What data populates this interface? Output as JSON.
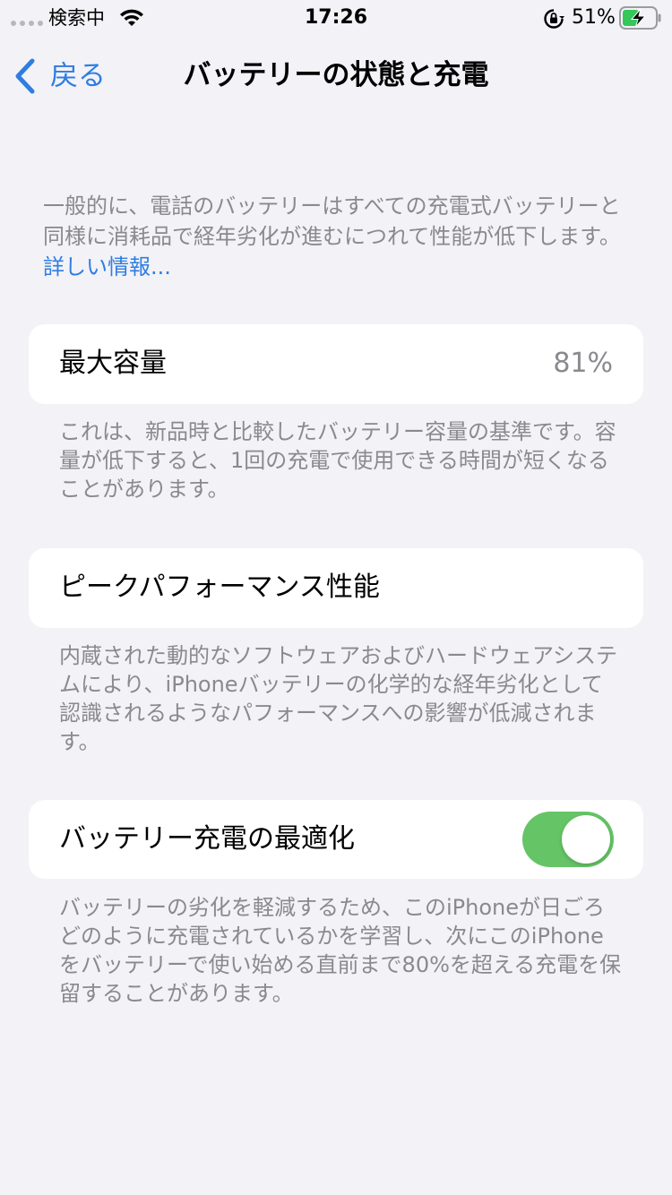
{
  "status_bar": {
    "carrier": "検索中",
    "time": "17:26",
    "battery_percent": "51%",
    "icons": [
      "signal-dots-icon",
      "wifi-icon",
      "rotation-lock-icon",
      "battery-charging-icon"
    ],
    "battery_level": 0.51
  },
  "nav": {
    "back_label": "戻る",
    "title": "バッテリーの状態と充電"
  },
  "intro": {
    "text": "一般的に、電話のバッテリーはすべての充電式バッテリーと同様に消耗品で経年劣化が進むにつれて性能が低下します。",
    "link": "詳しい情報..."
  },
  "max_capacity": {
    "label": "最大容量",
    "value": "81%",
    "footer": "これは、新品時と比較したバッテリー容量の基準です。容量が低下すると、1回の充電で使用できる時間が短くなることがあります。"
  },
  "peak_performance": {
    "label": "ピークパフォーマンス性能",
    "footer": "内蔵された動的なソフトウェアおよびハードウェアシステムにより、iPhoneバッテリーの化学的な経年劣化として認識されるようなパフォーマンスへの影響が低減されます。"
  },
  "optimized_charging": {
    "label": "バッテリー充電の最適化",
    "enabled": true,
    "footer": "バッテリーの劣化を軽減するため、このiPhoneが日ごろどのように充電されているかを学習し、次にこのiPhoneをバッテリーで使い始める直前まで80%を超える充電を保留することがあります。"
  },
  "colors": {
    "accent": "#2f7de1",
    "toggle_on": "#65c466",
    "background": "#f2f2f7",
    "secondary_text": "#8a8a8e",
    "battery_fill": "#34c759"
  }
}
